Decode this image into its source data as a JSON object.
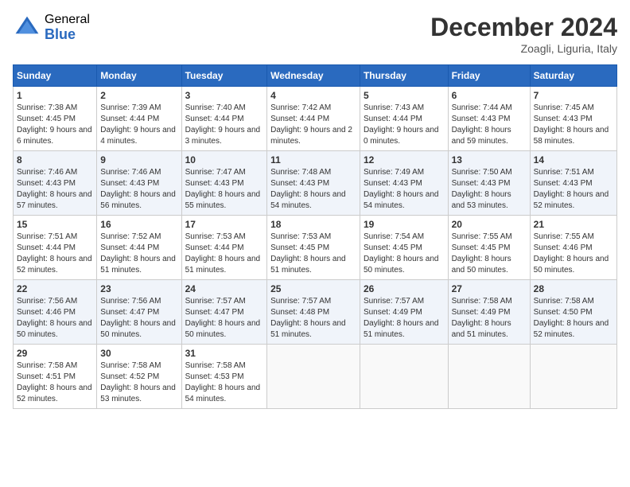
{
  "logo": {
    "general": "General",
    "blue": "Blue"
  },
  "title": "December 2024",
  "location": "Zoagli, Liguria, Italy",
  "days_of_week": [
    "Sunday",
    "Monday",
    "Tuesday",
    "Wednesday",
    "Thursday",
    "Friday",
    "Saturday"
  ],
  "weeks": [
    [
      {
        "day": "1",
        "sunrise": "7:38 AM",
        "sunset": "4:45 PM",
        "daylight": "9 hours and 6 minutes."
      },
      {
        "day": "2",
        "sunrise": "7:39 AM",
        "sunset": "4:44 PM",
        "daylight": "9 hours and 4 minutes."
      },
      {
        "day": "3",
        "sunrise": "7:40 AM",
        "sunset": "4:44 PM",
        "daylight": "9 hours and 3 minutes."
      },
      {
        "day": "4",
        "sunrise": "7:42 AM",
        "sunset": "4:44 PM",
        "daylight": "9 hours and 2 minutes."
      },
      {
        "day": "5",
        "sunrise": "7:43 AM",
        "sunset": "4:44 PM",
        "daylight": "9 hours and 0 minutes."
      },
      {
        "day": "6",
        "sunrise": "7:44 AM",
        "sunset": "4:43 PM",
        "daylight": "8 hours and 59 minutes."
      },
      {
        "day": "7",
        "sunrise": "7:45 AM",
        "sunset": "4:43 PM",
        "daylight": "8 hours and 58 minutes."
      }
    ],
    [
      {
        "day": "8",
        "sunrise": "7:46 AM",
        "sunset": "4:43 PM",
        "daylight": "8 hours and 57 minutes."
      },
      {
        "day": "9",
        "sunrise": "7:46 AM",
        "sunset": "4:43 PM",
        "daylight": "8 hours and 56 minutes."
      },
      {
        "day": "10",
        "sunrise": "7:47 AM",
        "sunset": "4:43 PM",
        "daylight": "8 hours and 55 minutes."
      },
      {
        "day": "11",
        "sunrise": "7:48 AM",
        "sunset": "4:43 PM",
        "daylight": "8 hours and 54 minutes."
      },
      {
        "day": "12",
        "sunrise": "7:49 AM",
        "sunset": "4:43 PM",
        "daylight": "8 hours and 54 minutes."
      },
      {
        "day": "13",
        "sunrise": "7:50 AM",
        "sunset": "4:43 PM",
        "daylight": "8 hours and 53 minutes."
      },
      {
        "day": "14",
        "sunrise": "7:51 AM",
        "sunset": "4:43 PM",
        "daylight": "8 hours and 52 minutes."
      }
    ],
    [
      {
        "day": "15",
        "sunrise": "7:51 AM",
        "sunset": "4:44 PM",
        "daylight": "8 hours and 52 minutes."
      },
      {
        "day": "16",
        "sunrise": "7:52 AM",
        "sunset": "4:44 PM",
        "daylight": "8 hours and 51 minutes."
      },
      {
        "day": "17",
        "sunrise": "7:53 AM",
        "sunset": "4:44 PM",
        "daylight": "8 hours and 51 minutes."
      },
      {
        "day": "18",
        "sunrise": "7:53 AM",
        "sunset": "4:45 PM",
        "daylight": "8 hours and 51 minutes."
      },
      {
        "day": "19",
        "sunrise": "7:54 AM",
        "sunset": "4:45 PM",
        "daylight": "8 hours and 50 minutes."
      },
      {
        "day": "20",
        "sunrise": "7:55 AM",
        "sunset": "4:45 PM",
        "daylight": "8 hours and 50 minutes."
      },
      {
        "day": "21",
        "sunrise": "7:55 AM",
        "sunset": "4:46 PM",
        "daylight": "8 hours and 50 minutes."
      }
    ],
    [
      {
        "day": "22",
        "sunrise": "7:56 AM",
        "sunset": "4:46 PM",
        "daylight": "8 hours and 50 minutes."
      },
      {
        "day": "23",
        "sunrise": "7:56 AM",
        "sunset": "4:47 PM",
        "daylight": "8 hours and 50 minutes."
      },
      {
        "day": "24",
        "sunrise": "7:57 AM",
        "sunset": "4:47 PM",
        "daylight": "8 hours and 50 minutes."
      },
      {
        "day": "25",
        "sunrise": "7:57 AM",
        "sunset": "4:48 PM",
        "daylight": "8 hours and 51 minutes."
      },
      {
        "day": "26",
        "sunrise": "7:57 AM",
        "sunset": "4:49 PM",
        "daylight": "8 hours and 51 minutes."
      },
      {
        "day": "27",
        "sunrise": "7:58 AM",
        "sunset": "4:49 PM",
        "daylight": "8 hours and 51 minutes."
      },
      {
        "day": "28",
        "sunrise": "7:58 AM",
        "sunset": "4:50 PM",
        "daylight": "8 hours and 52 minutes."
      }
    ],
    [
      {
        "day": "29",
        "sunrise": "7:58 AM",
        "sunset": "4:51 PM",
        "daylight": "8 hours and 52 minutes."
      },
      {
        "day": "30",
        "sunrise": "7:58 AM",
        "sunset": "4:52 PM",
        "daylight": "8 hours and 53 minutes."
      },
      {
        "day": "31",
        "sunrise": "7:58 AM",
        "sunset": "4:53 PM",
        "daylight": "8 hours and 54 minutes."
      },
      null,
      null,
      null,
      null
    ]
  ],
  "labels": {
    "sunrise": "Sunrise:",
    "sunset": "Sunset:",
    "daylight": "Daylight:"
  }
}
